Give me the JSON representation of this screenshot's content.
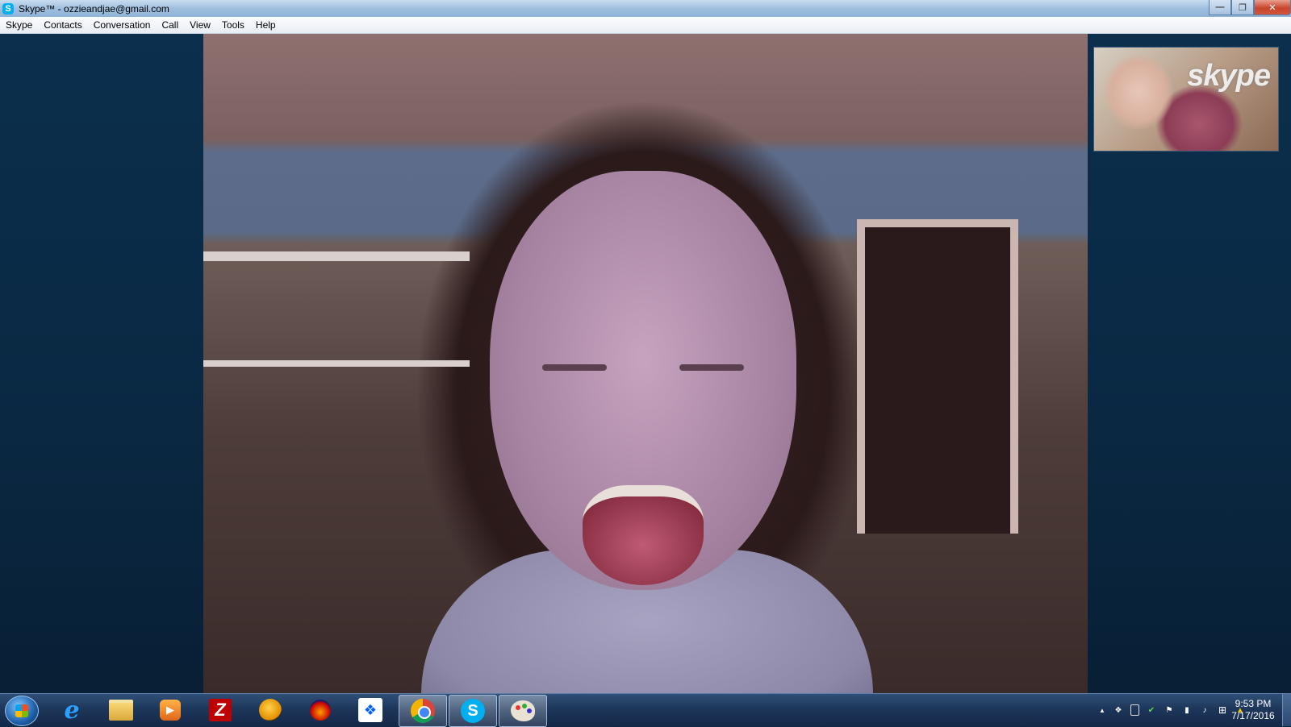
{
  "window": {
    "title": "Skype™ - ozzieandjae@gmail.com",
    "minimize_glyph": "—",
    "maximize_glyph": "❐",
    "close_glyph": "✕"
  },
  "menu": {
    "items": [
      "Skype",
      "Contacts",
      "Conversation",
      "Call",
      "View",
      "Tools",
      "Help"
    ]
  },
  "call": {
    "self_view_logo": "skype"
  },
  "taskbar": {
    "apps": [
      {
        "name": "internet-explorer",
        "glyph": "e",
        "active": false
      },
      {
        "name": "windows-explorer",
        "glyph": "",
        "active": false
      },
      {
        "name": "media-player",
        "glyph": "▶",
        "active": false
      },
      {
        "name": "filezilla",
        "glyph": "Z",
        "active": false
      },
      {
        "name": "fl-studio",
        "glyph": "",
        "active": false
      },
      {
        "name": "audacity",
        "glyph": "",
        "active": false
      },
      {
        "name": "dropbox",
        "glyph": "❖",
        "active": false
      },
      {
        "name": "chrome",
        "glyph": "",
        "active": true
      },
      {
        "name": "skype",
        "glyph": "S",
        "active": true
      },
      {
        "name": "paint",
        "glyph": "",
        "active": true
      }
    ],
    "tray": {
      "show_hidden_glyph": "▲",
      "icons": [
        "dropbox-tray-icon",
        "battery-icon",
        "security-icon",
        "action-center-flag-icon",
        "network-signal-icon",
        "volume-icon",
        "windows-update-icon",
        "google-drive-icon"
      ],
      "time": "9:53 PM",
      "date": "7/17/2016"
    }
  },
  "colors": {
    "skype_blue": "#00aff0",
    "window_background": "#0b2f4d"
  }
}
